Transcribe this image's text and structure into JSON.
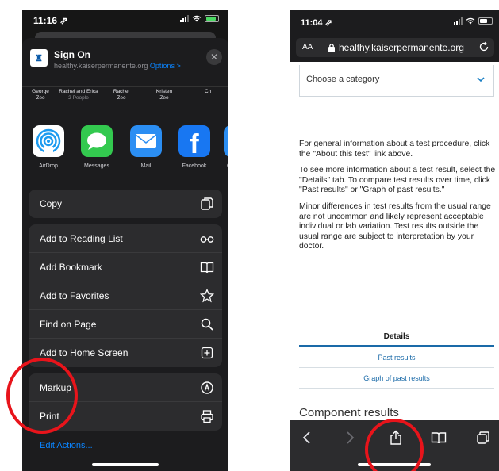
{
  "left": {
    "status": {
      "time": "11:16 ⇗"
    },
    "share_header": {
      "title": "Sign On",
      "domain": "healthy.kaiserpermanente.org",
      "options": "Options >",
      "site_icon": "kp-logo-icon"
    },
    "people": [
      {
        "name": "George",
        "sub": "Zee"
      },
      {
        "name": "Rachel and Erica",
        "sub": "2 People"
      },
      {
        "name": "Rachel",
        "sub": "Zee"
      },
      {
        "name": "Kristen",
        "sub": "Zee"
      },
      {
        "name": "",
        "sub": "Ch"
      }
    ],
    "apps": [
      {
        "label": "AirDrop",
        "icon": "airdrop-icon",
        "color": "#1d9bf0"
      },
      {
        "label": "Messages",
        "icon": "messages-icon",
        "color": "#33c94f"
      },
      {
        "label": "Mail",
        "icon": "mail-icon",
        "color": "#2b8ef3"
      },
      {
        "label": "Facebook",
        "icon": "facebook-icon",
        "color": "#1877f2"
      },
      {
        "label": "C",
        "icon": "partial-app-icon",
        "color": "#2b8ef3"
      }
    ],
    "actions_group1": [
      {
        "label": "Copy",
        "icon": "copy-icon"
      }
    ],
    "actions_group2": [
      {
        "label": "Add to Reading List",
        "icon": "glasses-icon"
      },
      {
        "label": "Add Bookmark",
        "icon": "book-icon"
      },
      {
        "label": "Add to Favorites",
        "icon": "star-icon"
      },
      {
        "label": "Find on Page",
        "icon": "search-icon"
      },
      {
        "label": "Add to Home Screen",
        "icon": "plus-square-icon"
      }
    ],
    "actions_group3": [
      {
        "label": "Markup",
        "icon": "markup-icon"
      },
      {
        "label": "Print",
        "icon": "printer-icon"
      }
    ],
    "edit_actions": "Edit Actions..."
  },
  "right": {
    "status": {
      "time": "11:04 ⇗"
    },
    "urlbar": {
      "aa": "AA",
      "url": "healthy.kaiserpermanente.org"
    },
    "category_select": "Choose a category",
    "paragraphs": [
      "For general information about a test procedure, click the \"About this test\" link above.",
      "To see more information about a test result, select the \"Details\" tab. To compare test results over time, click \"Past results\" or \"Graph of past results.\"",
      "Minor differences in test results from the usual range are not uncommon and likely represent acceptable individual or lab variation. Test results outside the usual range are subject to interpretation by your doctor."
    ],
    "tabs": [
      "Details",
      "Past results",
      "Graph of past results"
    ],
    "component_heading": "Component results",
    "toolbar_icons": [
      "back-icon",
      "forward-icon",
      "share-icon",
      "bookmarks-icon",
      "tabs-icon"
    ]
  },
  "annotation_color": "#e8141b"
}
